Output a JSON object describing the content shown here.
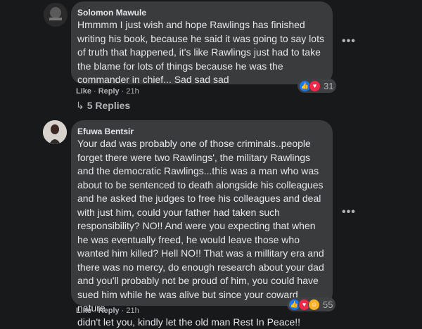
{
  "comments": [
    {
      "author": "Solomon Mawule",
      "text_lines": [
        "Hmmmm I just wish and hope Rawlings has finished",
        "writing his book, because he said it was going to say lots",
        "of truth that happened, it's like Rawlings just had to take",
        "the blame for lots of things because he was the",
        "commander in chief... Sad sad sad"
      ],
      "like_label": "Like",
      "reply_label": "Reply",
      "time": "21h",
      "reaction_icons": [
        "like-icon",
        "love-icon"
      ],
      "reaction_count": "31",
      "replies_label": "5 Replies"
    },
    {
      "author": "Efuwa Bentsir",
      "text_lines": [
        "Your dad was probably one of those criminals..people",
        "forget there were two Rawlings', the military Rawlings",
        "and the democratic Rawlings...this was a man who was",
        "about to be sentenced to death alongside his colleagues",
        "and he asked the judges to free his colleagues and deal",
        "with just him, could your father had taken such",
        "responsibility? NO!! And were you expecting that when",
        "he was eventually freed, he would leave those who",
        "wanted him killed? Hell NO!! That was a millitary era and",
        "there was no mercy, do enough research about your dad",
        "and you'll probably not be proud of him, you could have",
        "sued him while he was alive but since your coward nature",
        "didn't let you, kindly let the old man Rest In Peace!!"
      ],
      "like_label": "Like",
      "reply_label": "Reply",
      "time": "21h",
      "reaction_icons": [
        "like-icon",
        "love-icon",
        "haha-icon"
      ],
      "reaction_count": "55"
    }
  ],
  "more_icon": "more-options-icon",
  "colors": {
    "background": "#18191a",
    "bubble": "#3a3b3c",
    "text": "#e4e6eb",
    "secondary_text": "#b0b3b8",
    "like_blue": "#1877f2",
    "love_red": "#f02849",
    "haha_yellow": "#f7b125"
  }
}
